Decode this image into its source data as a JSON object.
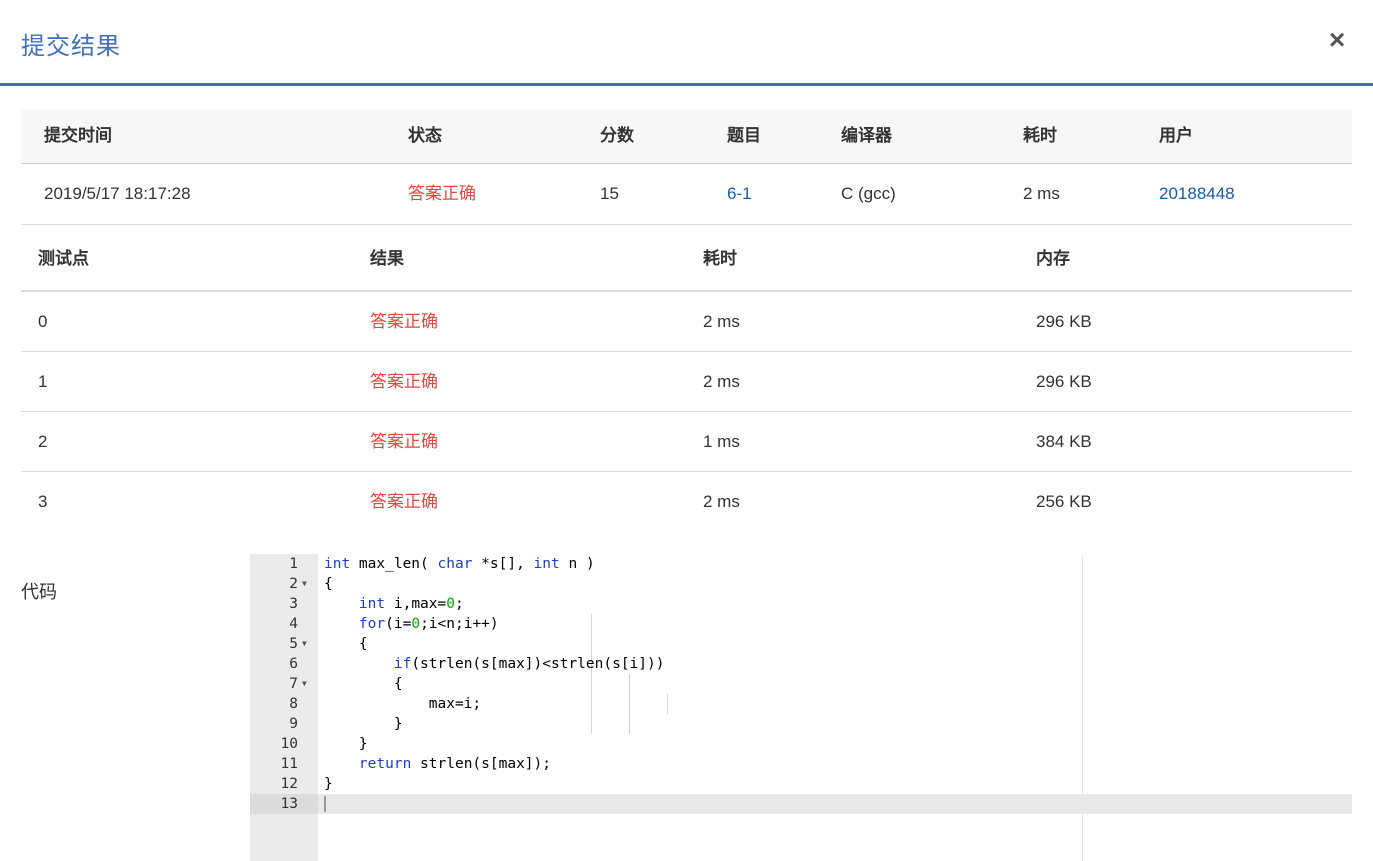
{
  "dialog": {
    "title": "提交结果",
    "close_glyph": "×"
  },
  "summary": {
    "headers": [
      "提交时间",
      "状态",
      "分数",
      "题目",
      "编译器",
      "耗时",
      "用户"
    ],
    "row": {
      "time": "2019/5/17 18:17:28",
      "status": "答案正确",
      "score": "15",
      "problem": "6-1",
      "compiler": "C (gcc)",
      "duration": "2 ms",
      "user": "20188448"
    }
  },
  "testcases": {
    "headers": [
      "测试点",
      "结果",
      "耗时",
      "内存"
    ],
    "rows": [
      {
        "id": "0",
        "result": "答案正确",
        "time": "2 ms",
        "memory": "296 KB"
      },
      {
        "id": "1",
        "result": "答案正确",
        "time": "2 ms",
        "memory": "296 KB"
      },
      {
        "id": "2",
        "result": "答案正确",
        "time": "1 ms",
        "memory": "384 KB"
      },
      {
        "id": "3",
        "result": "答案正确",
        "time": "2 ms",
        "memory": "256 KB"
      }
    ]
  },
  "code": {
    "label": "代码",
    "lines": [
      "int max_len( char *s[], int n )",
      "{",
      "    int i,max=0;",
      "    for(i=0;i<n;i++)",
      "    {",
      "        if(strlen(s[max])<strlen(s[i]))",
      "        {",
      "            max=i;",
      "        }",
      "    }",
      "    return strlen(s[max]);",
      "}",
      ""
    ],
    "fold_lines": [
      2,
      5,
      7
    ],
    "active_line": 13
  },
  "colors": {
    "accent": "#3f6fbf",
    "status_ok": "#e3473e",
    "link": "#1a5ba6"
  }
}
